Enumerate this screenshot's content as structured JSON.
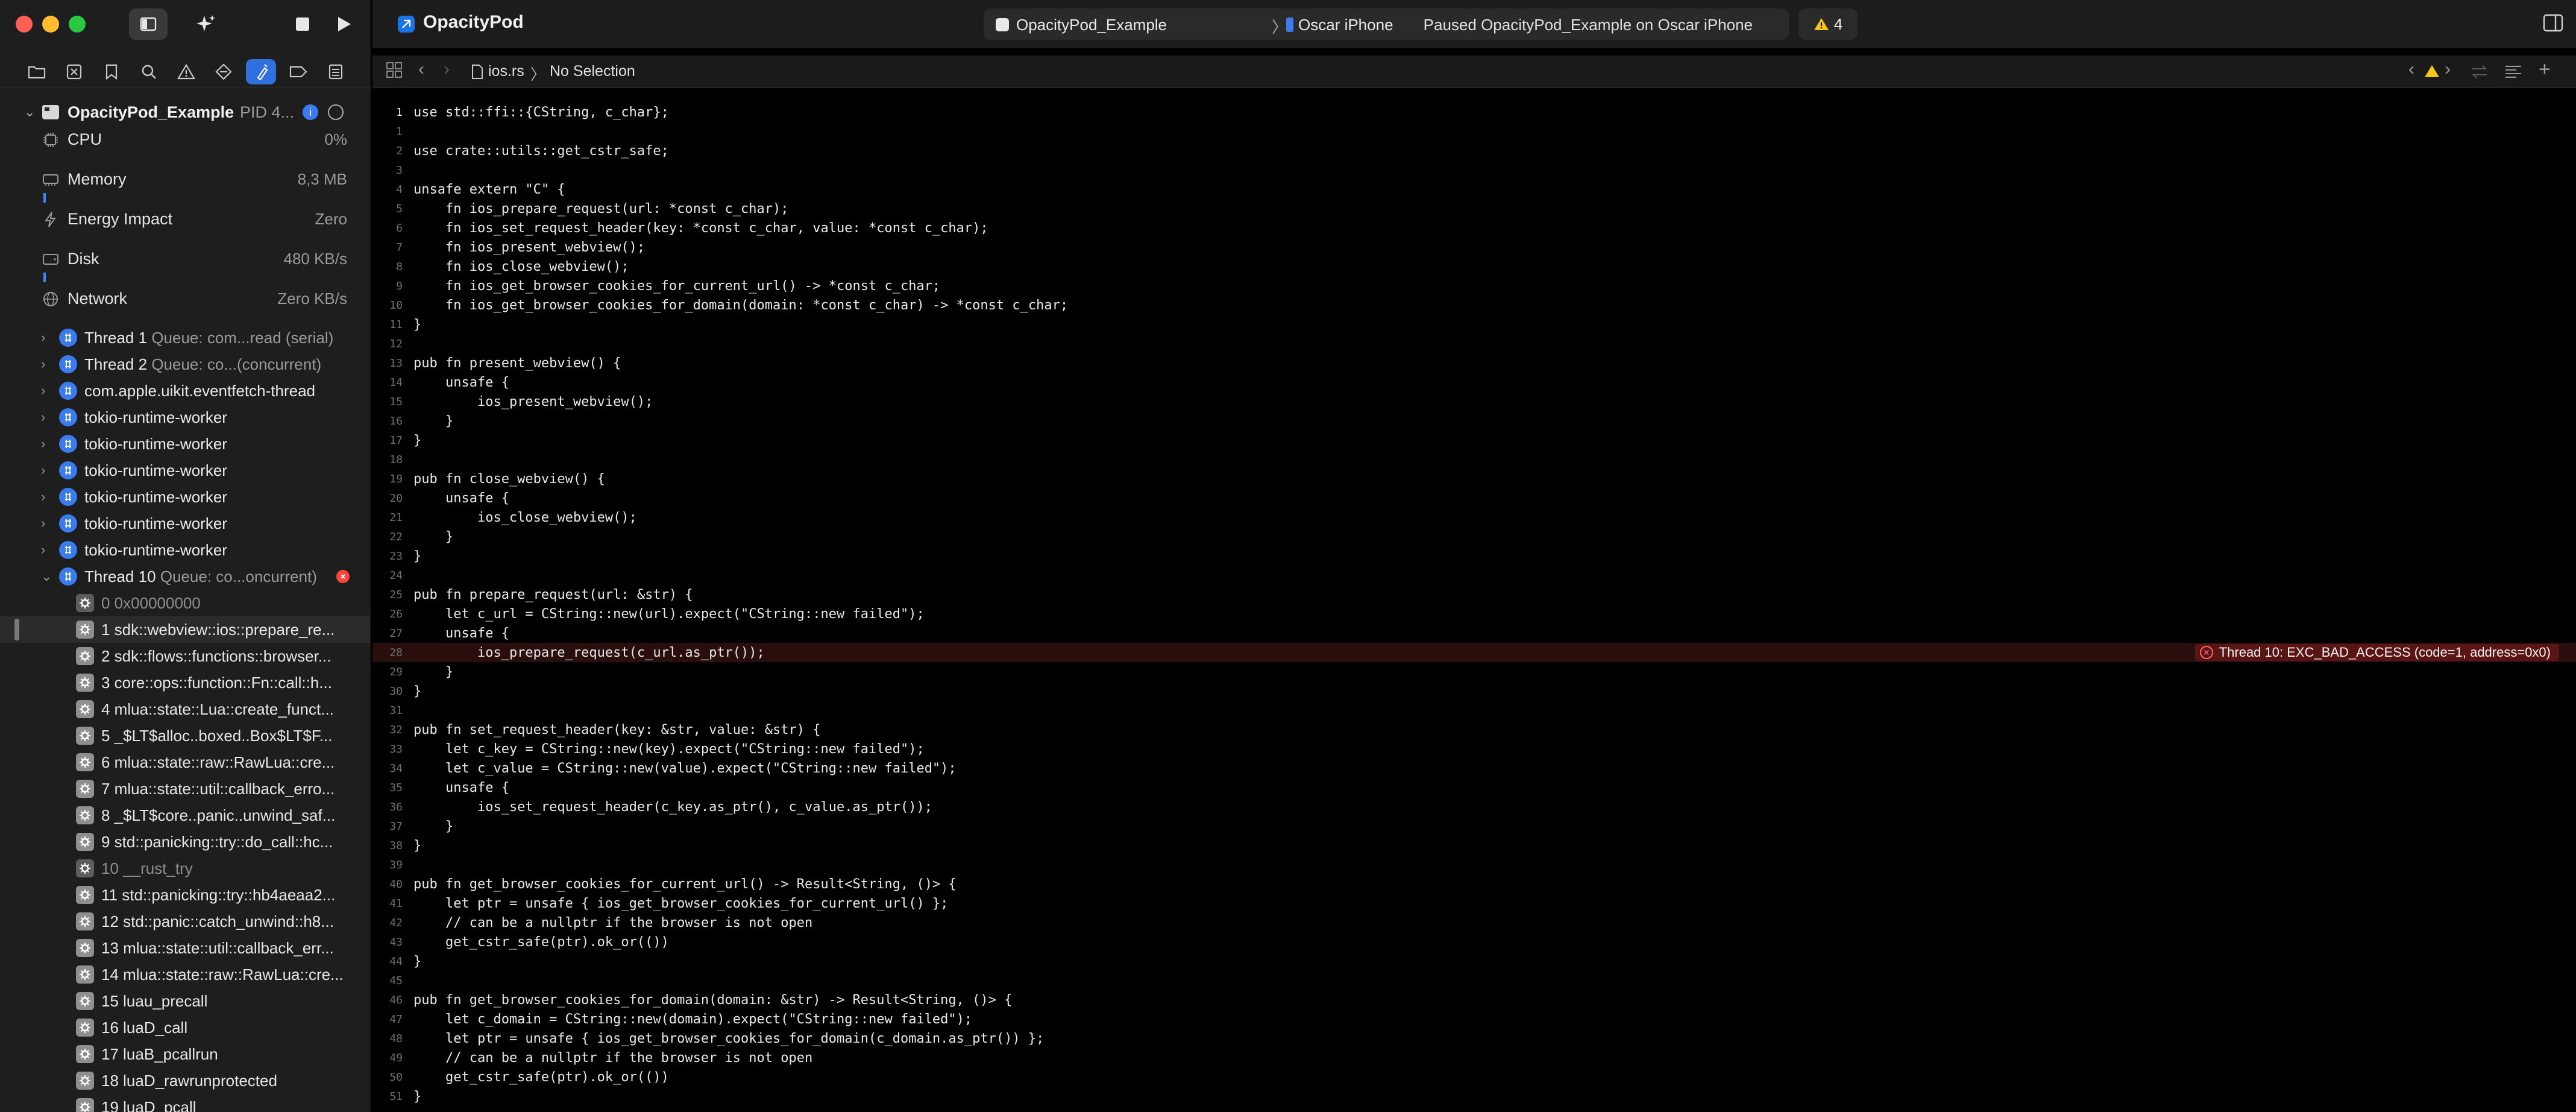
{
  "app": {
    "title": "OpacityPod",
    "scheme_target": "OpacityPod_Example",
    "scheme_sep": "〉",
    "scheme_device": "Oscar iPhone",
    "status": "Paused OpacityPod_Example on Oscar iPhone",
    "warning_count": "4"
  },
  "jumpbar": {
    "file": "ios.rs",
    "sep": "〉",
    "selection": "No Selection"
  },
  "process": {
    "name": "OpacityPod_Example",
    "pid": "PID 4...",
    "gauges": [
      {
        "label": "CPU",
        "value": "0%"
      },
      {
        "label": "Memory",
        "value": "8,3 MB"
      },
      {
        "label": "Energy Impact",
        "value": "Zero"
      },
      {
        "label": "Disk",
        "value": "480 KB/s"
      },
      {
        "label": "Network",
        "value": "Zero KB/s"
      }
    ]
  },
  "threads": [
    {
      "name": "Thread 1",
      "queue": "Queue: com...read (serial)"
    },
    {
      "name": "Thread 2",
      "queue": "Queue: co...(concurrent)"
    },
    {
      "name": "com.apple.uikit.eventfetch-thread",
      "queue": ""
    },
    {
      "name": "tokio-runtime-worker",
      "queue": ""
    },
    {
      "name": "tokio-runtime-worker",
      "queue": ""
    },
    {
      "name": "tokio-runtime-worker",
      "queue": ""
    },
    {
      "name": "tokio-runtime-worker",
      "queue": ""
    },
    {
      "name": "tokio-runtime-worker",
      "queue": ""
    },
    {
      "name": "tokio-runtime-worker",
      "queue": ""
    },
    {
      "name": "Thread 10",
      "queue": "Queue: co...oncurrent)"
    }
  ],
  "frames": [
    {
      "label": "0 0x00000000",
      "dim": true
    },
    {
      "label": "1 sdk::webview::ios::prepare_re...",
      "dim": false
    },
    {
      "label": "2 sdk::flows::functions::browser...",
      "dim": false
    },
    {
      "label": "3 core::ops::function::Fn::call::h...",
      "dim": false
    },
    {
      "label": "4 mlua::state::Lua::create_funct...",
      "dim": false
    },
    {
      "label": "5 _$LT$alloc..boxed..Box$LT$F...",
      "dim": false
    },
    {
      "label": "6 mlua::state::raw::RawLua::cre...",
      "dim": false
    },
    {
      "label": "7 mlua::state::util::callback_erro...",
      "dim": false
    },
    {
      "label": "8 _$LT$core..panic..unwind_saf...",
      "dim": false
    },
    {
      "label": "9 std::panicking::try::do_call::hc...",
      "dim": false
    },
    {
      "label": "10 __rust_try",
      "dim": true
    },
    {
      "label": "11 std::panicking::try::hb4aeaa2...",
      "dim": false
    },
    {
      "label": "12 std::panic::catch_unwind::h8...",
      "dim": false
    },
    {
      "label": "13 mlua::state::util::callback_err...",
      "dim": false
    },
    {
      "label": "14 mlua::state::raw::RawLua::cre...",
      "dim": false
    },
    {
      "label": "15 luau_precall",
      "dim": false
    },
    {
      "label": "16 luaD_call",
      "dim": false
    },
    {
      "label": "17 luaB_pcallrun",
      "dim": false
    },
    {
      "label": "18 luaD_rawrunprotected",
      "dim": false
    },
    {
      "label": "19 luaD_pcall",
      "dim": false
    }
  ],
  "error_banner": "Thread 10: EXC_BAD_ACCESS (code=1, address=0x0)",
  "code": [
    {
      "n": "1",
      "t": "use std::ffi::{CString, c_char};"
    },
    {
      "n": "1",
      "t": ""
    },
    {
      "n": "2",
      "t": "use crate::utils::get_cstr_safe;"
    },
    {
      "n": "3",
      "t": ""
    },
    {
      "n": "4",
      "t": "unsafe extern \"C\" {"
    },
    {
      "n": "5",
      "t": "    fn ios_prepare_request(url: *const c_char);"
    },
    {
      "n": "6",
      "t": "    fn ios_set_request_header(key: *const c_char, value: *const c_char);"
    },
    {
      "n": "7",
      "t": "    fn ios_present_webview();"
    },
    {
      "n": "8",
      "t": "    fn ios_close_webview();"
    },
    {
      "n": "9",
      "t": "    fn ios_get_browser_cookies_for_current_url() -> *const c_char;"
    },
    {
      "n": "10",
      "t": "    fn ios_get_browser_cookies_for_domain(domain: *const c_char) -> *const c_char;"
    },
    {
      "n": "11",
      "t": "}"
    },
    {
      "n": "12",
      "t": ""
    },
    {
      "n": "13",
      "t": "pub fn present_webview() {"
    },
    {
      "n": "14",
      "t": "    unsafe {"
    },
    {
      "n": "15",
      "t": "        ios_present_webview();"
    },
    {
      "n": "16",
      "t": "    }"
    },
    {
      "n": "17",
      "t": "}"
    },
    {
      "n": "18",
      "t": ""
    },
    {
      "n": "19",
      "t": "pub fn close_webview() {"
    },
    {
      "n": "20",
      "t": "    unsafe {"
    },
    {
      "n": "21",
      "t": "        ios_close_webview();"
    },
    {
      "n": "22",
      "t": "    }"
    },
    {
      "n": "23",
      "t": "}"
    },
    {
      "n": "24",
      "t": ""
    },
    {
      "n": "25",
      "t": "pub fn prepare_request(url: &str) {"
    },
    {
      "n": "26",
      "t": "    let c_url = CString::new(url).expect(\"CString::new failed\");"
    },
    {
      "n": "27",
      "t": "    unsafe {"
    },
    {
      "n": "28",
      "t": "        ios_prepare_request(c_url.as_ptr());"
    },
    {
      "n": "29",
      "t": "    }"
    },
    {
      "n": "30",
      "t": "}"
    },
    {
      "n": "31",
      "t": ""
    },
    {
      "n": "32",
      "t": "pub fn set_request_header(key: &str, value: &str) {"
    },
    {
      "n": "33",
      "t": "    let c_key = CString::new(key).expect(\"CString::new failed\");"
    },
    {
      "n": "34",
      "t": "    let c_value = CString::new(value).expect(\"CString::new failed\");"
    },
    {
      "n": "35",
      "t": "    unsafe {"
    },
    {
      "n": "36",
      "t": "        ios_set_request_header(c_key.as_ptr(), c_value.as_ptr());"
    },
    {
      "n": "37",
      "t": "    }"
    },
    {
      "n": "38",
      "t": "}"
    },
    {
      "n": "39",
      "t": ""
    },
    {
      "n": "40",
      "t": "pub fn get_browser_cookies_for_current_url() -> Result<String, ()> {"
    },
    {
      "n": "41",
      "t": "    let ptr = unsafe { ios_get_browser_cookies_for_current_url() };"
    },
    {
      "n": "42",
      "t": "    // can be a nullptr if the browser is not open"
    },
    {
      "n": "43",
      "t": "    get_cstr_safe(ptr).ok_or(())"
    },
    {
      "n": "44",
      "t": "}"
    },
    {
      "n": "45",
      "t": ""
    },
    {
      "n": "46",
      "t": "pub fn get_browser_cookies_for_domain(domain: &str) -> Result<String, ()> {"
    },
    {
      "n": "47",
      "t": "    let c_domain = CString::new(domain).expect(\"CString::new failed\");"
    },
    {
      "n": "48",
      "t": "    let ptr = unsafe { ios_get_browser_cookies_for_domain(c_domain.as_ptr()) };"
    },
    {
      "n": "49",
      "t": "    // can be a nullptr if the browser is not open"
    },
    {
      "n": "50",
      "t": "    get_cstr_safe(ptr).ok_or(())"
    },
    {
      "n": "51",
      "t": "}"
    }
  ],
  "colors": {
    "accent": "#2f6fde",
    "error": "#ff453a",
    "error_line_bg": "#2a0d0d"
  }
}
